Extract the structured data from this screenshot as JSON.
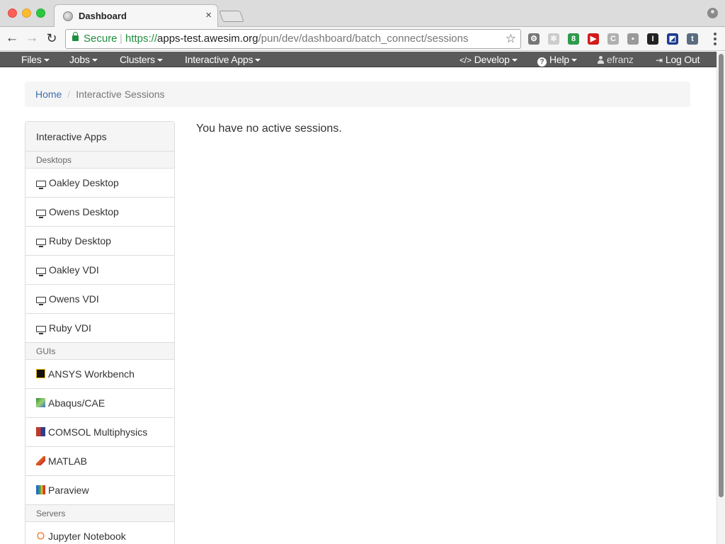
{
  "browser": {
    "tab_title": "Dashboard",
    "tab_close": "×",
    "secure_label": "Secure",
    "url_separator": "|",
    "url_protocol": "https://",
    "url_host": "apps-test.awesim.org",
    "url_path": "/pun/dev/dashboard/batch_connect/sessions",
    "nav": {
      "back": "←",
      "forward": "→",
      "reload": "↻"
    },
    "star": "☆",
    "extensions": [
      {
        "name": "gear-extension",
        "glyph": "⚙",
        "color": "#777777"
      },
      {
        "name": "puzzle-extension",
        "glyph": "✲",
        "color": "#cccccc"
      },
      {
        "name": "green-extension",
        "glyph": "8",
        "color": "#2e9a4a"
      },
      {
        "name": "youtube-extension",
        "glyph": "▶",
        "color": "#d11a1a"
      },
      {
        "name": "c-extension",
        "glyph": "C",
        "color": "#b0b0b0"
      },
      {
        "name": "square-extension",
        "glyph": "▪",
        "color": "#9a9a9a"
      },
      {
        "name": "instapaper-extension",
        "glyph": "I",
        "color": "#222222"
      },
      {
        "name": "flag-extension",
        "glyph": "◩",
        "color": "#1b3c8e"
      },
      {
        "name": "tumblr-extension",
        "glyph": "t",
        "color": "#5b6c7f"
      }
    ]
  },
  "navbar": {
    "left": [
      "Files",
      "Jobs",
      "Clusters",
      "Interactive Apps"
    ],
    "develop": "Develop",
    "develop_icon": "</>",
    "help": "Help",
    "help_icon": "?",
    "user": "efranz",
    "logout": "Log Out"
  },
  "breadcrumb": {
    "home": "Home",
    "separator": "/",
    "current": "Interactive Sessions"
  },
  "sidebar": {
    "heading": "Interactive Apps",
    "sections": [
      {
        "label": "Desktops",
        "items": [
          {
            "label": "Oakley Desktop",
            "icon": "monitor"
          },
          {
            "label": "Owens Desktop",
            "icon": "monitor"
          },
          {
            "label": "Ruby Desktop",
            "icon": "monitor"
          },
          {
            "label": "Oakley VDI",
            "icon": "monitor"
          },
          {
            "label": "Owens VDI",
            "icon": "monitor"
          },
          {
            "label": "Ruby VDI",
            "icon": "monitor"
          }
        ]
      },
      {
        "label": "GUIs",
        "items": [
          {
            "label": "ANSYS Workbench",
            "icon": "ansys"
          },
          {
            "label": "Abaqus/CAE",
            "icon": "abaqus"
          },
          {
            "label": "COMSOL Multiphysics",
            "icon": "comsol"
          },
          {
            "label": "MATLAB",
            "icon": "matlab"
          },
          {
            "label": "Paraview",
            "icon": "paraview"
          }
        ]
      },
      {
        "label": "Servers",
        "items": [
          {
            "label": "Jupyter Notebook",
            "icon": "jupyter"
          }
        ]
      }
    ]
  },
  "main": {
    "message": "You have no active sessions."
  }
}
